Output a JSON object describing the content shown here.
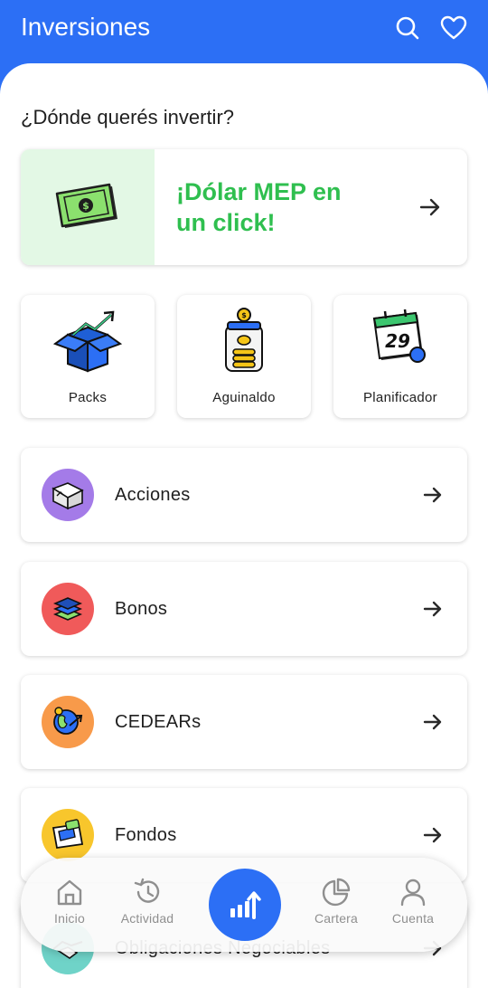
{
  "header": {
    "title": "Inversiones",
    "search_icon": "search-icon",
    "favorite_icon": "heart-icon"
  },
  "section": {
    "question": "¿Dónde querés invertir?"
  },
  "promo": {
    "text": "¡Dólar MEP en un click!",
    "icon": "banknote-icon",
    "color": "#2fbf4f",
    "bg": "#e3f8e5"
  },
  "tiles": [
    {
      "label": "Packs",
      "icon": "box-growth-icon"
    },
    {
      "label": "Aguinaldo",
      "icon": "coin-jar-icon"
    },
    {
      "label": "Planificador",
      "icon": "calendar-icon"
    }
  ],
  "instruments": [
    {
      "label": "Acciones",
      "icon": "stocks-icon",
      "color": "#a47be8"
    },
    {
      "label": "Bonos",
      "icon": "stack-icon",
      "color": "#f05a5a"
    },
    {
      "label": "CEDEARs",
      "icon": "globe-icon",
      "color": "#f89a4a"
    },
    {
      "label": "Fondos",
      "icon": "folder-money-icon",
      "color": "#f8c62c"
    },
    {
      "label": "Obligaciones Negociables",
      "icon": "handshake-icon",
      "color": "#6fd3c8"
    }
  ],
  "nav": {
    "items": [
      {
        "label": "Inicio",
        "icon": "home-icon"
      },
      {
        "label": "Actividad",
        "icon": "history-icon"
      },
      {
        "label": "Cartera",
        "icon": "pie-chart-icon"
      },
      {
        "label": "Cuenta",
        "icon": "user-icon"
      }
    ],
    "center_icon": "invest-chart-icon"
  },
  "colors": {
    "primary": "#2c6ff5",
    "text": "#1f1f1f",
    "muted": "#8f8f8f"
  }
}
